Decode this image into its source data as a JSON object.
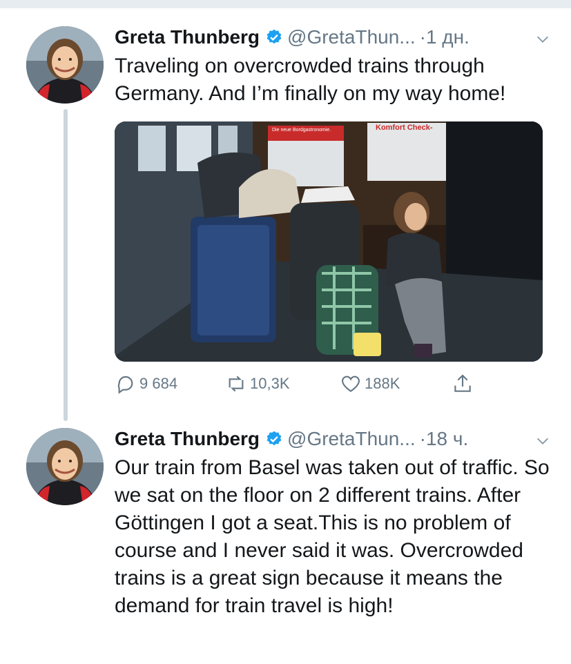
{
  "tweets": [
    {
      "name": "Greta Thunberg",
      "handle": "@GretaThun...",
      "time": "·1 дн.",
      "text": "Traveling on overcrowded trains through Germany. And I’m finally on my way home!",
      "photo": {
        "signs": [
          "Die neue Bordgastronomie.",
          "Komfort Check-"
        ]
      },
      "stats": {
        "replies": "9 684",
        "retweets": "10,3K",
        "likes": "188K"
      }
    },
    {
      "name": "Greta Thunberg",
      "handle": "@GretaThun...",
      "time": "·18 ч.",
      "text": "Our train from Basel was taken out of traffic. So we sat on the floor on 2 different trains. After Göttingen I got a seat.This is no problem of course and I never said it was. Overcrowded trains is a great sign because it means the demand for train travel is high!"
    }
  ],
  "icons": {
    "verified": "verified-badge-icon",
    "more": "chevron-down-icon",
    "reply": "reply-icon",
    "retweet": "retweet-icon",
    "like": "heart-icon",
    "share": "share-icon"
  },
  "colors": {
    "verified": "#1da1f2",
    "secondary": "#657786",
    "thread_line": "#ccd6dd"
  }
}
